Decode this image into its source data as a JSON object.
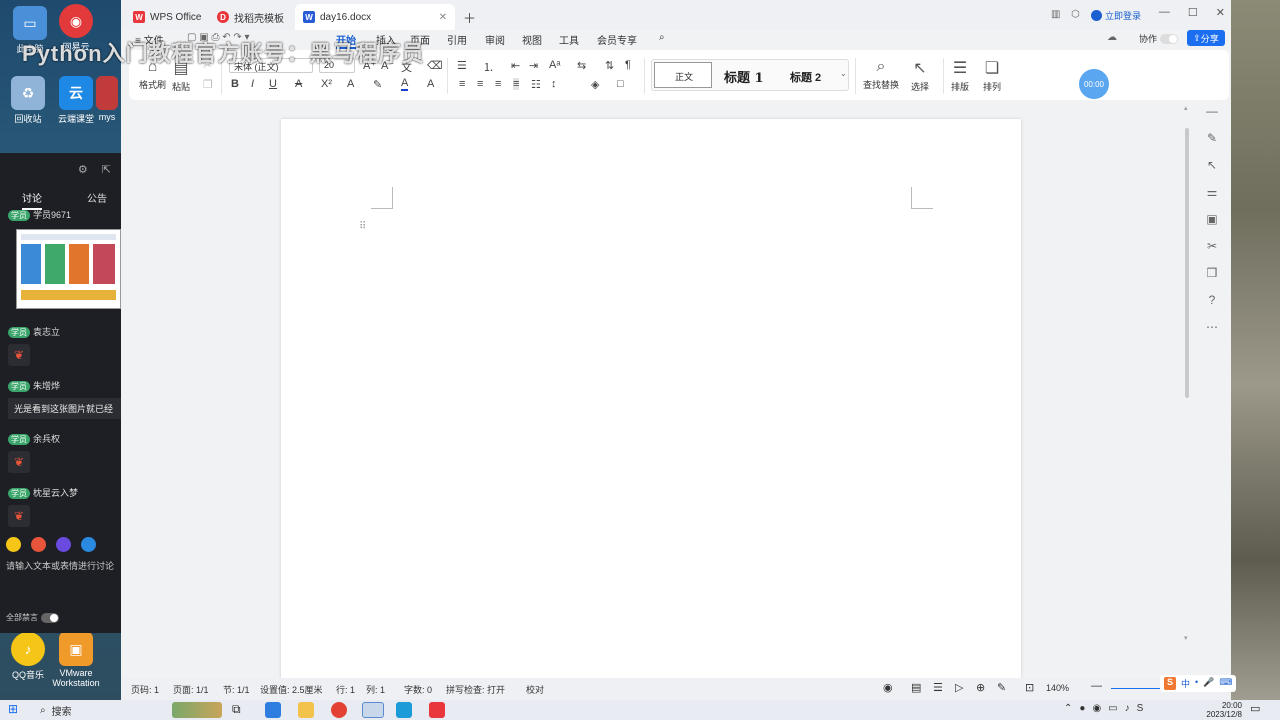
{
  "overlay_title": "Python入门教程官方账号：黑马程序员",
  "desktop": {
    "icons": [
      {
        "label": "此电脑",
        "icon": "computer-icon"
      },
      {
        "label": "网易云",
        "icon": "netease-music-icon"
      },
      {
        "label": "回收站",
        "icon": "recycle-bin-icon"
      },
      {
        "label": "云端课堂",
        "icon": "cloud-class-icon"
      },
      {
        "label": "mys",
        "icon": "mysql-icon"
      },
      {
        "label": "QQ音乐",
        "icon": "qq-music-icon"
      },
      {
        "label": "VMware Workstation",
        "icon": "vmware-icon"
      }
    ]
  },
  "chat": {
    "tabs": [
      "讨论",
      "公告"
    ],
    "messages": [
      {
        "badge": "学员",
        "name": "学员9671"
      },
      {
        "badge": "学员",
        "name": "袁志立"
      },
      {
        "badge": "学员",
        "name": "朱增烨",
        "text": "光是看到这张图片就已经"
      },
      {
        "badge": "学员",
        "name": "余兵权"
      },
      {
        "badge": "学员",
        "name": "枕星云入梦"
      }
    ],
    "input_placeholder": "请输入文本或表情进行讨论",
    "mute_all": "全部禁言"
  },
  "titlebar": {
    "tabs": [
      {
        "label": "WPS Office",
        "icon": "wps-logo-icon"
      },
      {
        "label": "找稻壳模板",
        "icon": "docer-icon"
      },
      {
        "label": "day16.docx",
        "icon": "word-doc-icon",
        "active": true
      }
    ],
    "login": "立即登录"
  },
  "menu": {
    "file": "文件",
    "items": [
      "开始",
      "插入",
      "页面",
      "引用",
      "审阅",
      "视图",
      "工具",
      "会员专享"
    ],
    "active": "开始",
    "collab": "协作",
    "share": "分享"
  },
  "ribbon": {
    "format_painter": "格式刷",
    "paste": "粘贴",
    "font_name": "宋体 (正文)",
    "font_size": "20",
    "styles": [
      "正文",
      "标题 1",
      "标题 2"
    ],
    "find_replace": "查找替换",
    "select": "选择",
    "layout": "排版",
    "arrange": "排列"
  },
  "timer": "00:00",
  "status": {
    "page_no": "页码: 1",
    "pages": "页面: 1/1",
    "section": "节: 1/1",
    "setting": "设置值: 2.5厘米",
    "row": "行: 1",
    "col": "列: 1",
    "words": "字数: 0",
    "spell": "拼写检查: 打开",
    "proof": "校对",
    "zoom": "140%"
  },
  "taskbar": {
    "search": "搜索",
    "time": "20:00",
    "date": "2023/12/8",
    "ime": "中"
  },
  "colors": {
    "accent": "#1b6ef0",
    "wps_red": "#e8363c",
    "word_blue": "#2a5bd7"
  }
}
